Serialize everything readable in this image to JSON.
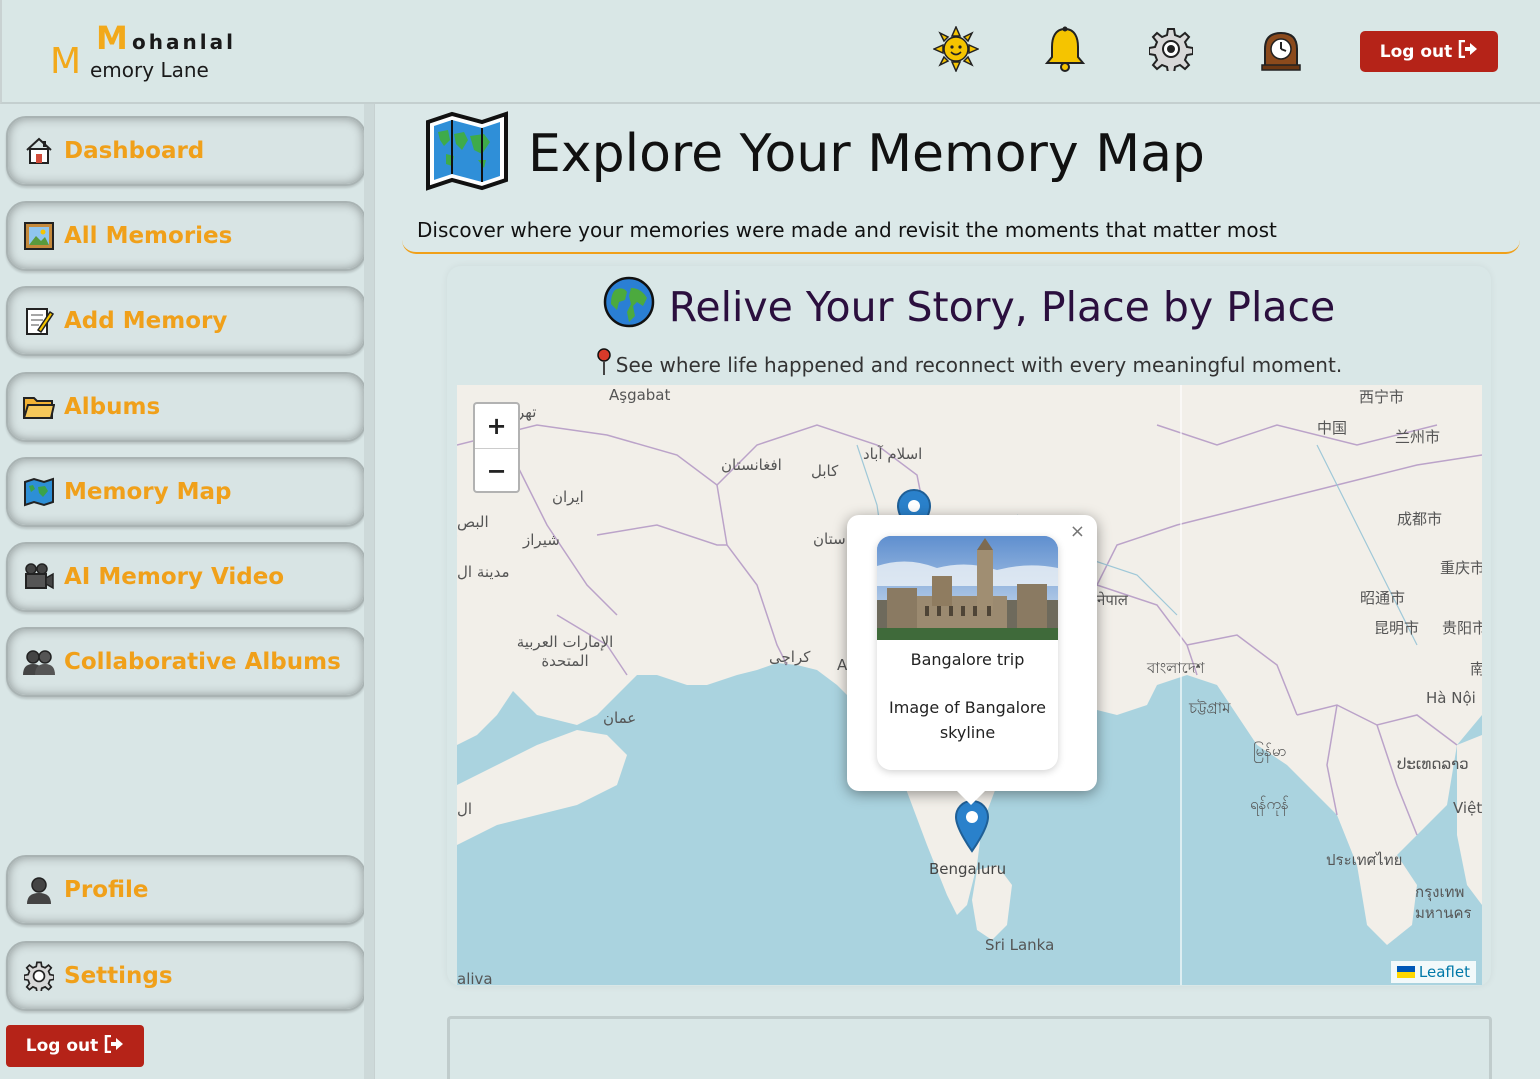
{
  "brand": {
    "m1": "M",
    "ohanlal": "ohanlal",
    "m2": "M",
    "emory": "emory Lane"
  },
  "header": {
    "icons": [
      "sun-icon",
      "bell-icon",
      "gear-icon",
      "clock-icon"
    ],
    "logout_label": "Log out"
  },
  "sidebar": {
    "items": [
      {
        "label": "Dashboard",
        "icon": "house-icon"
      },
      {
        "label": "All Memories",
        "icon": "picture-icon"
      },
      {
        "label": "Add Memory",
        "icon": "memo-icon"
      },
      {
        "label": "Albums",
        "icon": "folder-icon"
      },
      {
        "label": "Memory Map",
        "icon": "map-icon"
      },
      {
        "label": "AI Memory Video",
        "icon": "camera-icon"
      },
      {
        "label": "Collaborative Albums",
        "icon": "people-icon"
      }
    ],
    "profile_label": "Profile",
    "settings_label": "Settings",
    "logout_label": "Log out"
  },
  "page": {
    "title": "Explore Your Memory Map",
    "subtitle": "Discover where your memories were made and revisit the moments that matter most"
  },
  "map_card": {
    "heading": "Relive Your Story, Place by Place",
    "subheading": "See where life happened and reconnect with every meaningful moment."
  },
  "map": {
    "zoom_in": "+",
    "zoom_out": "−",
    "attribution": "Leaflet",
    "labels": {
      "ashgabat": "Aşgabat",
      "tehran": "تهر",
      "iran": "ایران",
      "shiraz": "شیراز",
      "basra": "البص",
      "madina": "مدينة ال",
      "afghanistan": "افغانستان",
      "kabul": "کابل",
      "islamabad": "اسلام آباد",
      "pakistan_frag": "ستان",
      "karachi": "کراچی",
      "uae": "الإمارات العربية المتحدة",
      "oman": "عمان",
      "yemen_frag": "ال",
      "xining": "西宁市",
      "china": "中国",
      "lanzhou": "兰州市",
      "chengdu": "成都市",
      "chongqing": "重庆市",
      "zhaotong": "昭通市",
      "kunming": "昆明市",
      "guiyang": "贵阳市",
      "nanning_frag": "南",
      "hanoi": "Hà Nội",
      "bangladesh": "বাংলাদেশ",
      "chittagong": "চট্টগ্রাম",
      "myanmar": "မြန်မာ",
      "yangon": "ရန်ကုန်",
      "laos": "ປະເທດລາວ",
      "thailand": "ประเทศไทย",
      "bangkok": "กรุงเทพ",
      "bangkok2": "มหานคร",
      "vietnam_frag": "Việt",
      "nepal_frag": "नेपाल",
      "bengaluru": "Bengaluru",
      "srilanka": "Sri Lanka",
      "maldives_frag": "aliva",
      "agra_frag": "A"
    },
    "popup": {
      "title": "Bangalore trip",
      "description": "Image of Bangalore skyline",
      "close": "×"
    }
  }
}
